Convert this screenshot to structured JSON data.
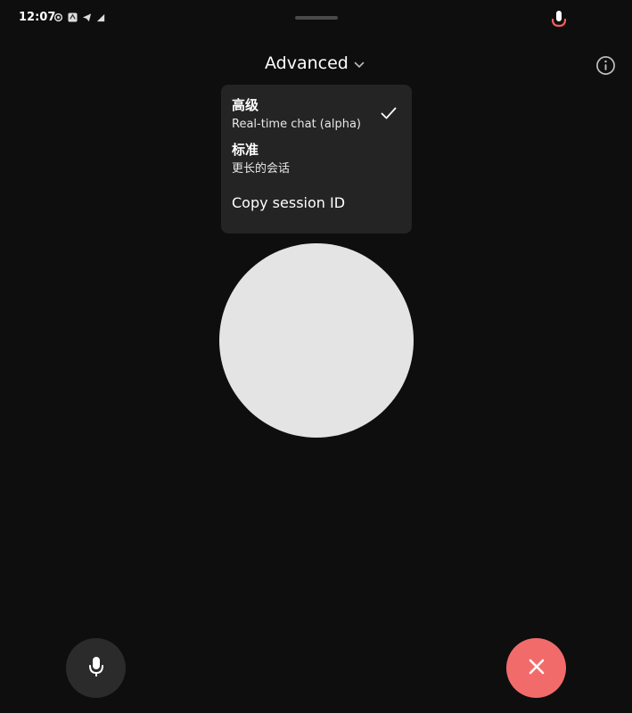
{
  "status_bar": {
    "time": "12:07",
    "icons": [
      "gear-status-icon",
      "app-status-icon",
      "telegram-icon",
      "signal-icon"
    ],
    "mic_active_color": "#f25c5c"
  },
  "header": {
    "mode_label": "Advanced",
    "mode_icon": "chevron-down-icon",
    "info_icon": "info-icon"
  },
  "menu": {
    "items": [
      {
        "title": "高级",
        "subtitle": "Real-time chat (alpha)",
        "selected": true
      },
      {
        "title": "标准",
        "subtitle": "更长的会话",
        "selected": false
      }
    ],
    "copy_label": "Copy session ID"
  },
  "controls": {
    "mic_icon": "microphone-icon",
    "end_icon": "close-icon",
    "end_color": "#f26b6b"
  }
}
